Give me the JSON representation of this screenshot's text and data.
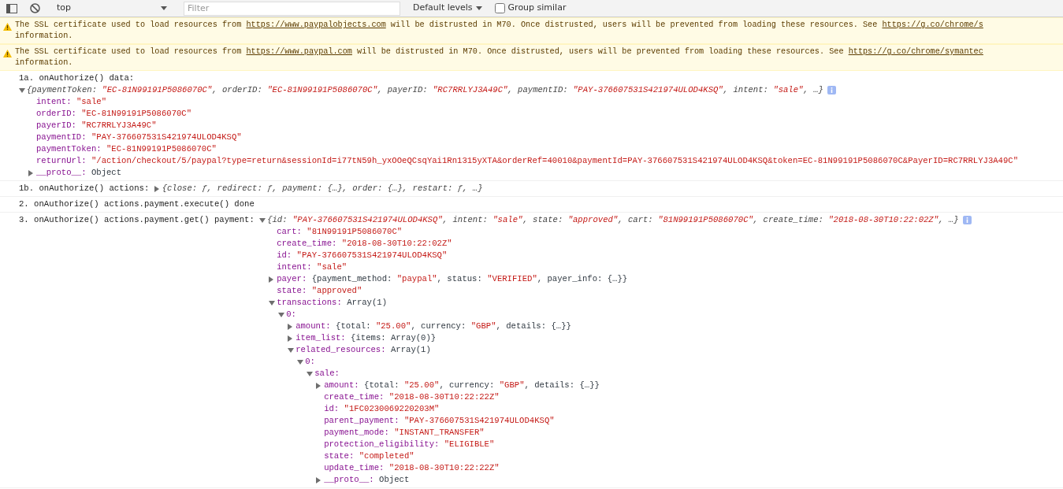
{
  "toolbar": {
    "context": "top",
    "filter_placeholder": "Filter",
    "levels": "Default levels",
    "group_similar": {
      "label": "Group similar",
      "checked": false
    }
  },
  "messages": [
    {
      "kind": "warning",
      "parts": [
        {
          "text": "The SSL certificate used to load resources from ",
          "link": false
        },
        {
          "text": "https://www.paypalobjects.com",
          "link": true
        },
        {
          "text": " will be distrusted in M70. Once distrusted, users will be prevented from loading these resources. See ",
          "link": false
        },
        {
          "text": "https://g.co/chrome/s",
          "link": true
        }
      ],
      "continuation": "information."
    },
    {
      "kind": "warning",
      "parts": [
        {
          "text": "The SSL certificate used to load resources from ",
          "link": false
        },
        {
          "text": "https://www.paypal.com",
          "link": true
        },
        {
          "text": " will be distrusted in M70. Once distrusted, users will be prevented from loading these resources. See ",
          "link": false
        },
        {
          "text": "https://g.co/chrome/symantec",
          "link": true
        }
      ],
      "continuation": "information."
    },
    {
      "kind": "log",
      "text": "1a. onAuthorize() data:",
      "value_below": true,
      "value": {
        "expanded": true,
        "preview": [
          {
            "text": "{paymentToken: ",
            "kind": "plain"
          },
          {
            "text": "\"EC-81N99191P5086070C\"",
            "kind": "string"
          },
          {
            "text": ", orderID: ",
            "kind": "plain"
          },
          {
            "text": "\"EC-81N99191P5086070C\"",
            "kind": "string"
          },
          {
            "text": ", payerID: ",
            "kind": "plain"
          },
          {
            "text": "\"RC7RRLYJ3A49C\"",
            "kind": "string"
          },
          {
            "text": ", paymentID: ",
            "kind": "plain"
          },
          {
            "text": "\"PAY-376607531S421974ULOD4KSQ\"",
            "kind": "string"
          },
          {
            "text": ", intent: ",
            "kind": "plain"
          },
          {
            "text": "\"sale\"",
            "kind": "string"
          },
          {
            "text": ", …}",
            "kind": "plain"
          }
        ],
        "children": [
          {
            "key": "intent:",
            "value": "\"sale\"",
            "kind": "string"
          },
          {
            "key": "orderID:",
            "value": "\"EC-81N99191P5086070C\"",
            "kind": "string"
          },
          {
            "key": "payerID:",
            "value": "\"RC7RRLYJ3A49C\"",
            "kind": "string"
          },
          {
            "key": "paymentID:",
            "value": "\"PAY-376607531S421974ULOD4KSQ\"",
            "kind": "string"
          },
          {
            "key": "paymentToken:",
            "value": "\"EC-81N99191P5086070C\"",
            "kind": "string"
          },
          {
            "key": "returnUrl:",
            "value": "\"/action/checkout/5/paypal?type=return&sessionId=i77tN59h_yxOOeQCsqYai1Rn1315yXTA&orderRef=40010&paymentId=PAY-376607531S421974ULOD4KSQ&token=EC-81N99191P5086070C&PayerID=RC7RRLYJ3A49C\"",
            "kind": "string"
          },
          {
            "key": "__proto__:",
            "value": "Object",
            "kind": "object",
            "expanded": false
          }
        ]
      }
    },
    {
      "kind": "log",
      "text": "1b. onAuthorize() actions:",
      "value_below": false,
      "value": {
        "expanded": false,
        "preview": [
          {
            "text": "{close: ƒ, redirect: ƒ, payment: {…}, order: {…}, restart: ƒ, …}",
            "kind": "plain"
          }
        ]
      }
    },
    {
      "kind": "log",
      "text": "2. onAuthorize() actions.payment.execute() done"
    },
    {
      "kind": "log",
      "text": "3. onAuthorize() actions.payment.get() payment:",
      "value_below": false,
      "value": {
        "expanded": true,
        "preview": [
          {
            "text": "{id: ",
            "kind": "plain"
          },
          {
            "text": "\"PAY-376607531S421974ULOD4KSQ\"",
            "kind": "string"
          },
          {
            "text": ", intent: ",
            "kind": "plain"
          },
          {
            "text": "\"sale\"",
            "kind": "string"
          },
          {
            "text": ", state: ",
            "kind": "plain"
          },
          {
            "text": "\"approved\"",
            "kind": "string"
          },
          {
            "text": ", cart: ",
            "kind": "plain"
          },
          {
            "text": "\"81N99191P5086070C\"",
            "kind": "string"
          },
          {
            "text": ", create_time: ",
            "kind": "plain"
          },
          {
            "text": "\"2018-08-30T10:22:02Z\"",
            "kind": "string"
          },
          {
            "text": ", …}",
            "kind": "plain"
          }
        ],
        "children": [
          {
            "key": "cart:",
            "value": "\"81N99191P5086070C\"",
            "kind": "string"
          },
          {
            "key": "create_time:",
            "value": "\"2018-08-30T10:22:02Z\"",
            "kind": "string"
          },
          {
            "key": "id:",
            "value": "\"PAY-376607531S421974ULOD4KSQ\"",
            "kind": "string"
          },
          {
            "key": "intent:",
            "value": "\"sale\"",
            "kind": "string"
          },
          {
            "key": "payer:",
            "expanded": false,
            "preview": [
              {
                "text": "{payment_method: ",
                "kind": "plain"
              },
              {
                "text": "\"paypal\"",
                "kind": "string"
              },
              {
                "text": ", status: ",
                "kind": "plain"
              },
              {
                "text": "\"VERIFIED\"",
                "kind": "string"
              },
              {
                "text": ", payer_info: {…}}",
                "kind": "plain"
              }
            ]
          },
          {
            "key": "state:",
            "value": "\"approved\"",
            "kind": "string"
          },
          {
            "key": "transactions:",
            "value": "Array(1)",
            "kind": "object",
            "expanded": true,
            "children": [
              {
                "key": "0:",
                "expanded": true,
                "children": [
                  {
                    "key": "amount:",
                    "expanded": false,
                    "preview": [
                      {
                        "text": "{total: ",
                        "kind": "plain"
                      },
                      {
                        "text": "\"25.00\"",
                        "kind": "string"
                      },
                      {
                        "text": ", currency: ",
                        "kind": "plain"
                      },
                      {
                        "text": "\"GBP\"",
                        "kind": "string"
                      },
                      {
                        "text": ", details: {…}}",
                        "kind": "plain"
                      }
                    ]
                  },
                  {
                    "key": "item_list:",
                    "expanded": false,
                    "preview": [
                      {
                        "text": "{items: Array(0)}",
                        "kind": "plain"
                      }
                    ]
                  },
                  {
                    "key": "related_resources:",
                    "value": "Array(1)",
                    "kind": "object",
                    "expanded": true,
                    "children": [
                      {
                        "key": "0:",
                        "expanded": true,
                        "children": [
                          {
                            "key": "sale:",
                            "expanded": true,
                            "children": [
                              {
                                "key": "amount:",
                                "expanded": false,
                                "preview": [
                                  {
                                    "text": "{total: ",
                                    "kind": "plain"
                                  },
                                  {
                                    "text": "\"25.00\"",
                                    "kind": "string"
                                  },
                                  {
                                    "text": ", currency: ",
                                    "kind": "plain"
                                  },
                                  {
                                    "text": "\"GBP\"",
                                    "kind": "string"
                                  },
                                  {
                                    "text": ", details: {…}}",
                                    "kind": "plain"
                                  }
                                ]
                              },
                              {
                                "key": "create_time:",
                                "value": "\"2018-08-30T10:22:22Z\"",
                                "kind": "string"
                              },
                              {
                                "key": "id:",
                                "value": "\"1FC0230069220203M\"",
                                "kind": "string"
                              },
                              {
                                "key": "parent_payment:",
                                "value": "\"PAY-376607531S421974ULOD4KSQ\"",
                                "kind": "string"
                              },
                              {
                                "key": "payment_mode:",
                                "value": "\"INSTANT_TRANSFER\"",
                                "kind": "string"
                              },
                              {
                                "key": "protection_eligibility:",
                                "value": "\"ELIGIBLE\"",
                                "kind": "string"
                              },
                              {
                                "key": "state:",
                                "value": "\"completed\"",
                                "kind": "string"
                              },
                              {
                                "key": "update_time:",
                                "value": "\"2018-08-30T10:22:22Z\"",
                                "kind": "string"
                              },
                              {
                                "key": "__proto__:",
                                "value": "Object",
                                "kind": "object",
                                "expanded": false
                              }
                            ]
                          }
                        ]
                      }
                    ]
                  }
                ]
              }
            ]
          }
        ]
      }
    }
  ]
}
